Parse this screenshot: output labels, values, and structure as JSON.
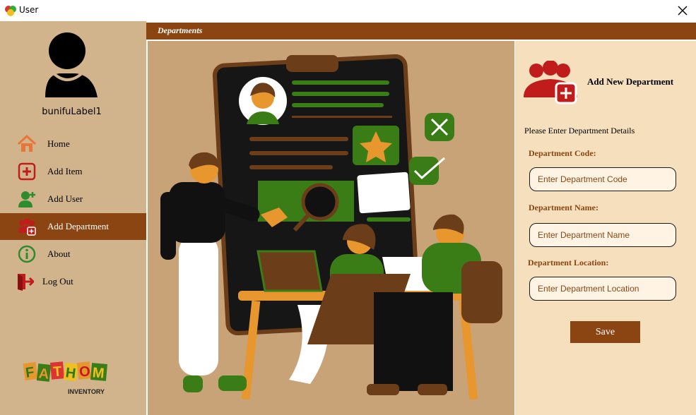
{
  "window": {
    "title": "User",
    "app_icon": "app-icon",
    "close_icon": "close-icon"
  },
  "sidebar": {
    "avatar_icon": "user-avatar-icon",
    "user_label": "bunifuLabel1",
    "items": [
      {
        "label": "Home",
        "icon": "home-icon"
      },
      {
        "label": "Add Item",
        "icon": "add-item-icon"
      },
      {
        "label": "Add User",
        "icon": "add-user-icon"
      },
      {
        "label": "Add Department",
        "icon": "add-department-icon",
        "active": true
      },
      {
        "label": "About",
        "icon": "info-icon"
      },
      {
        "label": "Log Out",
        "icon": "logout-icon"
      }
    ],
    "logo": {
      "wordmark": "FATHOM",
      "subtitle": "INVENTORY"
    }
  },
  "header": {
    "title": "Departments"
  },
  "form": {
    "title": "Add New Department",
    "subtitle": "Please Enter Department Details",
    "fields": [
      {
        "label": "Department Code:",
        "placeholder": "Enter Department Code"
      },
      {
        "label": "Department Name:",
        "placeholder": "Enter Department Name"
      },
      {
        "label": "Department Location:",
        "placeholder": "Enter Department Location"
      }
    ],
    "save_label": "Save"
  },
  "colors": {
    "sidebar_bg": "#d2b48c",
    "accent": "#8b4513",
    "form_bg": "#f5dfbd",
    "illustration_bg": "#c9a378",
    "green": "#3a7d16",
    "orange": "#e8962e"
  }
}
